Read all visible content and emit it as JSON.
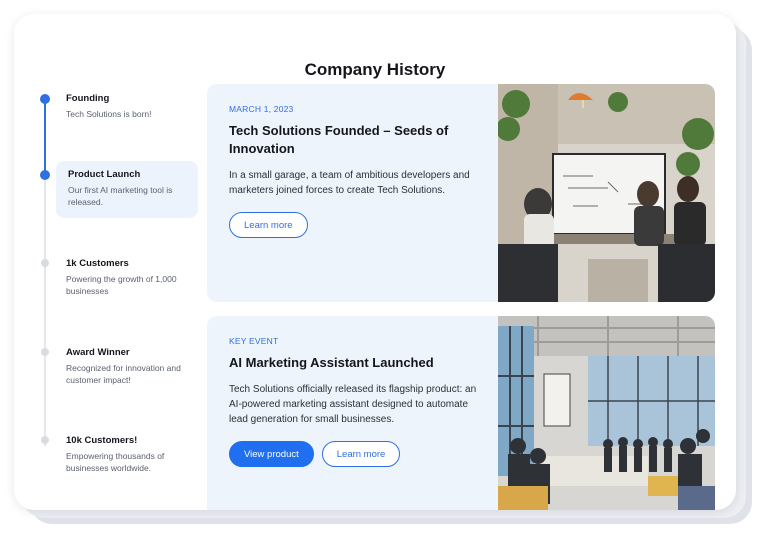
{
  "title": "Company History",
  "timeline": [
    {
      "label": "Founding",
      "desc": "Tech Solutions is born!"
    },
    {
      "label": "Product Launch",
      "desc": "Our first AI marketing tool is released."
    },
    {
      "label": "1k Customers",
      "desc": "Powering the growth of 1,000 businesses"
    },
    {
      "label": "Award Winner",
      "desc": "Recognized for innovation and customer impact!"
    },
    {
      "label": "10k Customers!",
      "desc": "Empowering thousands of businesses worldwide."
    }
  ],
  "events": [
    {
      "eyebrow": "MARCH 1, 2023",
      "title": "Tech Solutions Founded – Seeds of Innovation",
      "desc": "In a small garage, a team of ambitious developers and marketers joined forces to create Tech Solutions.",
      "learn_more": "Learn more",
      "photo_icon": "team-meeting-photo"
    },
    {
      "eyebrow": "KEY EVENT",
      "title": "AI Marketing Assistant Launched",
      "desc": "Tech Solutions officially released its flagship product: an AI-powered marketing assistant designed to automate lead generation for small businesses.",
      "view_product": "View product",
      "learn_more": "Learn more",
      "photo_icon": "launch-event-photo"
    }
  ],
  "colors": {
    "accent": "#2f6fe4",
    "panel_bg": "#eef4fc"
  }
}
